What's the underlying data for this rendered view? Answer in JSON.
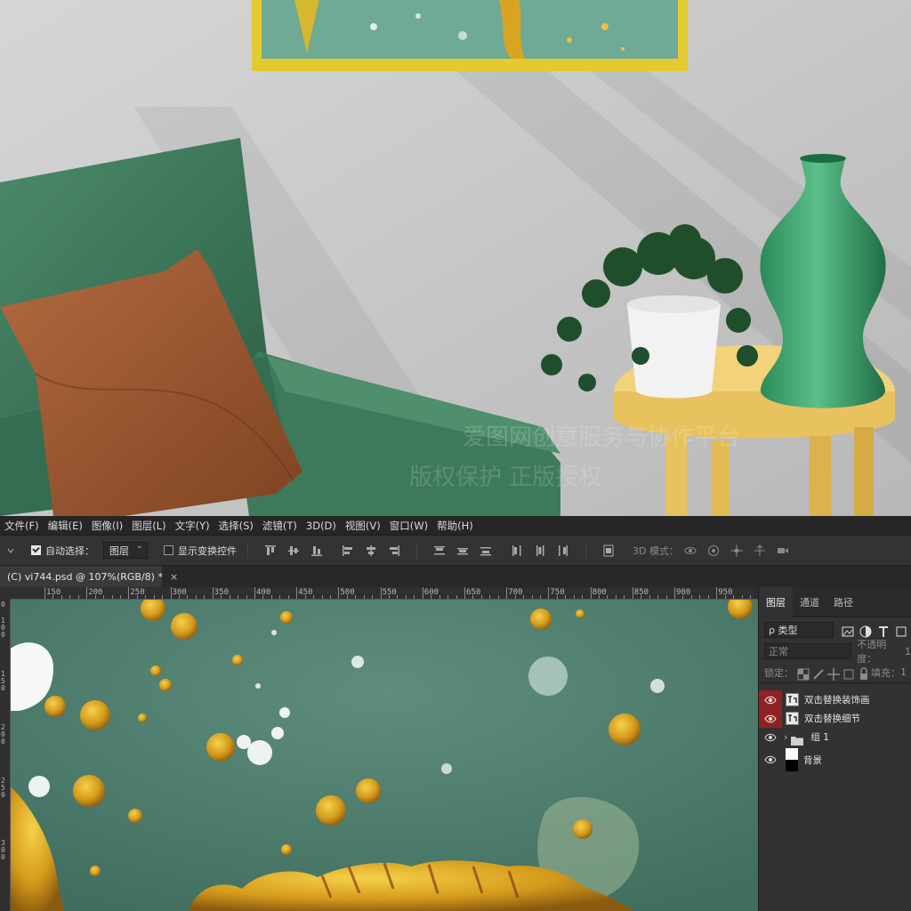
{
  "menu": [
    "文件(F)",
    "编辑(E)",
    "图像(I)",
    "图层(L)",
    "文字(Y)",
    "选择(S)",
    "滤镜(T)",
    "3D(D)",
    "视图(V)",
    "窗口(W)",
    "帮助(H)"
  ],
  "options": {
    "auto_select_label": "自动选择：",
    "auto_select_checked": true,
    "auto_select_value": "图层",
    "show_transform_label": "显示变换控件",
    "show_transform_checked": false,
    "mode_3d_label": "3D 模式："
  },
  "document_tab": {
    "title": "(C) vi744.psd @ 107%(RGB/8) *",
    "close": "×"
  },
  "ruler": {
    "horizontal": [
      "150",
      "200",
      "250",
      "300",
      "350",
      "400",
      "450",
      "500",
      "550",
      "600",
      "650",
      "700",
      "750",
      "800",
      "850",
      "900",
      "950"
    ],
    "vertical": [
      "0",
      "100",
      "150",
      "200",
      "250",
      "300"
    ]
  },
  "panel": {
    "tabs": [
      "图层",
      "通道",
      "路径"
    ],
    "filter_label": "ρ 类型",
    "blend_mode": "正常",
    "opacity_label": "不透明度：",
    "opacity_value": "1",
    "lock_label": "锁定：",
    "fill_label": "填充：",
    "fill_value": "1",
    "layers": [
      {
        "name": "双击替换装饰画",
        "visible_highlight": true,
        "type": "smart-object"
      },
      {
        "name": "双击替换细节",
        "visible_highlight": true,
        "type": "smart-object"
      },
      {
        "name": "组 1",
        "visible_highlight": false,
        "type": "group"
      },
      {
        "name": "背景",
        "visible_highlight": false,
        "type": "background"
      }
    ]
  },
  "watermark": {
    "line1": "爱图网创意服务与协作平台",
    "line2": "版权保护 正版授权"
  },
  "colors": {
    "accent_red": "#8f2323",
    "canvas_green": "#4f7f6f",
    "gold": "#d9a521"
  }
}
